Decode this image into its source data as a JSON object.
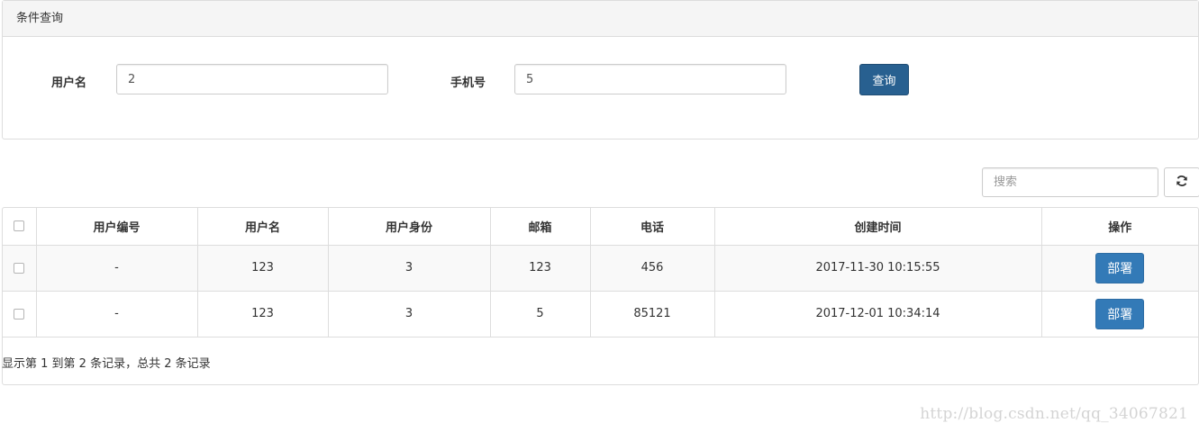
{
  "panel": {
    "title": "条件查询"
  },
  "query_form": {
    "username_label": "用户名",
    "username_value": "2",
    "phone_label": "手机号",
    "phone_value": "5",
    "query_button": "查询"
  },
  "toolbar": {
    "search_placeholder": "搜索",
    "refresh_icon": "refresh-icon"
  },
  "table": {
    "headers": [
      "用户编号",
      "用户名",
      "用户身份",
      "邮箱",
      "电话",
      "创建时间",
      "操作"
    ],
    "rows": [
      {
        "id": "-",
        "username": "123",
        "identity": "3",
        "email": "123",
        "phone": "456",
        "created": "2017-11-30 10:15:55",
        "action": "部署"
      },
      {
        "id": "-",
        "username": "123",
        "identity": "3",
        "email": "5",
        "phone": "85121",
        "created": "2017-12-01 10:34:14",
        "action": "部署"
      }
    ]
  },
  "pagination": {
    "info": "显示第 1 到第 2 条记录，总共 2 条记录"
  },
  "watermark": "http://blog.csdn.net/qq_34067821",
  "colors": {
    "primary": "#337ab7",
    "primary_dark": "#286090",
    "border": "#dddddd",
    "heading_bg": "#f5f5f5"
  }
}
